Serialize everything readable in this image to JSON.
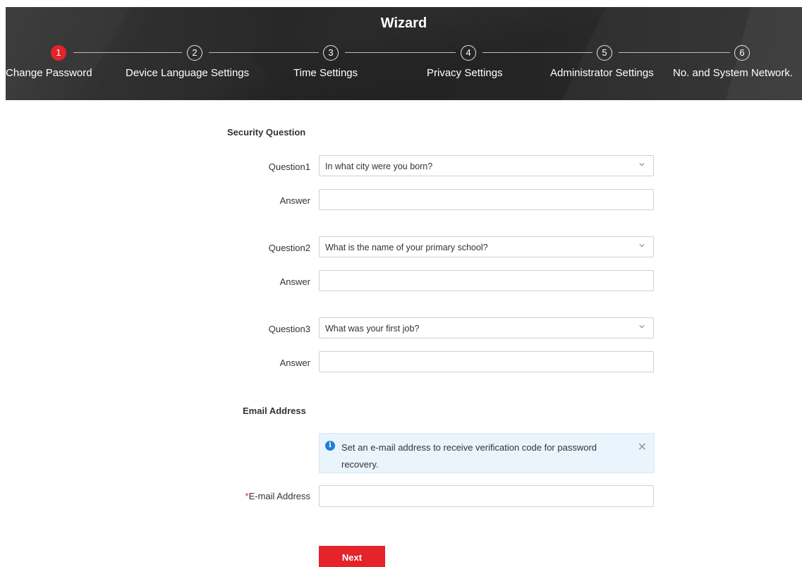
{
  "wizard": {
    "title": "Wizard",
    "steps": [
      {
        "number": "1",
        "label": "Change Password",
        "active": true
      },
      {
        "number": "2",
        "label": "Device Language Settings",
        "active": false
      },
      {
        "number": "3",
        "label": "Time Settings",
        "active": false
      },
      {
        "number": "4",
        "label": "Privacy Settings",
        "active": false
      },
      {
        "number": "5",
        "label": "Administrator Settings",
        "active": false
      },
      {
        "number": "6",
        "label": "No. and System Network.",
        "active": false
      }
    ]
  },
  "security": {
    "title": "Security Question",
    "questions": [
      {
        "label": "Question1",
        "value": "In what city were you born?",
        "answer_label": "Answer",
        "answer": ""
      },
      {
        "label": "Question2",
        "value": "What is the name of your primary school?",
        "answer_label": "Answer",
        "answer": ""
      },
      {
        "label": "Question3",
        "value": "What was your first job?",
        "answer_label": "Answer",
        "answer": ""
      }
    ]
  },
  "email": {
    "title": "Email Address",
    "notice": "Set an e-mail address to receive verification code for password recovery.",
    "required_mark": "*",
    "label": "E-mail Address",
    "value": ""
  },
  "actions": {
    "next_label": "Next"
  },
  "colors": {
    "accent": "#e4232b",
    "info": "#1e7fd9",
    "notice_bg": "#eaf4fc"
  }
}
